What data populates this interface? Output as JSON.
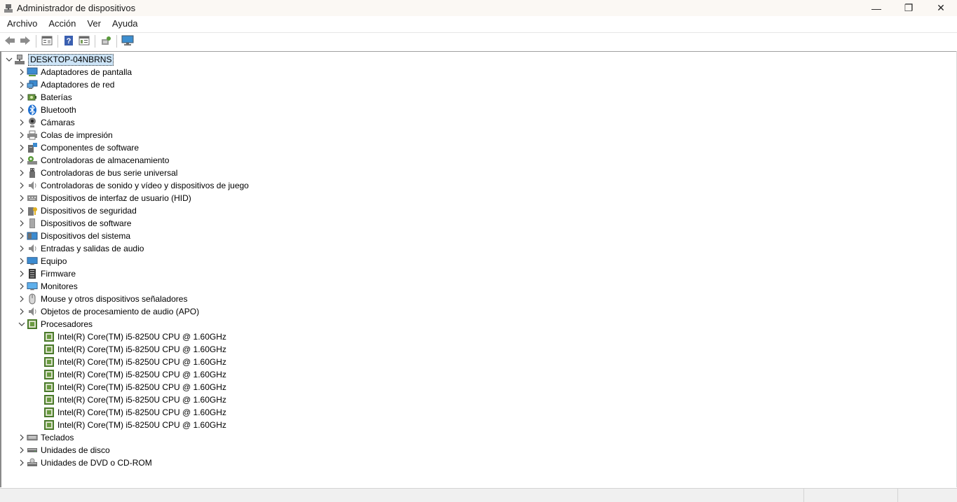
{
  "window": {
    "title": "Administrador de dispositivos",
    "minimize_glyph": "—",
    "restore_glyph": "❐",
    "close_glyph": "✕"
  },
  "menu": [
    "Archivo",
    "Acción",
    "Ver",
    "Ayuda"
  ],
  "toolbar": {
    "buttons": [
      "back-icon",
      "forward-icon",
      "properties-view-icon",
      "help-icon",
      "show-hide-tree-icon",
      "scan-hardware-icon",
      "monitor-icon"
    ]
  },
  "tree": {
    "root": "DESKTOP-04NBRNS",
    "categories": [
      {
        "label": "Adaptadores de pantalla",
        "icon": "display-adapter-icon",
        "expanded": false
      },
      {
        "label": "Adaptadores de red",
        "icon": "network-adapter-icon",
        "expanded": false
      },
      {
        "label": "Baterías",
        "icon": "battery-icon",
        "expanded": false
      },
      {
        "label": "Bluetooth",
        "icon": "bluetooth-icon",
        "expanded": false
      },
      {
        "label": "Cámaras",
        "icon": "camera-icon",
        "expanded": false
      },
      {
        "label": "Colas de impresión",
        "icon": "printer-icon",
        "expanded": false
      },
      {
        "label": "Componentes de software",
        "icon": "software-component-icon",
        "expanded": false
      },
      {
        "label": "Controladoras de almacenamiento",
        "icon": "storage-controller-icon",
        "expanded": false
      },
      {
        "label": "Controladoras de bus serie universal",
        "icon": "usb-icon",
        "expanded": false
      },
      {
        "label": "Controladoras de sonido y vídeo y dispositivos de juego",
        "icon": "speaker-icon",
        "expanded": false
      },
      {
        "label": "Dispositivos de interfaz de usuario (HID)",
        "icon": "hid-icon",
        "expanded": false
      },
      {
        "label": "Dispositivos de seguridad",
        "icon": "security-key-icon",
        "expanded": false
      },
      {
        "label": "Dispositivos de software",
        "icon": "software-device-icon",
        "expanded": false
      },
      {
        "label": "Dispositivos del sistema",
        "icon": "system-device-icon",
        "expanded": false
      },
      {
        "label": "Entradas y salidas de audio",
        "icon": "audio-io-icon",
        "expanded": false
      },
      {
        "label": "Equipo",
        "icon": "computer-icon",
        "expanded": false
      },
      {
        "label": "Firmware",
        "icon": "firmware-icon",
        "expanded": false
      },
      {
        "label": "Monitores",
        "icon": "monitor-icon",
        "expanded": false
      },
      {
        "label": "Mouse y otros dispositivos señaladores",
        "icon": "mouse-icon",
        "expanded": false
      },
      {
        "label": "Objetos de procesamiento de audio (APO)",
        "icon": "apo-icon",
        "expanded": false
      },
      {
        "label": "Procesadores",
        "icon": "processor-icon",
        "expanded": true,
        "children": [
          "Intel(R) Core(TM) i5-8250U CPU @ 1.60GHz",
          "Intel(R) Core(TM) i5-8250U CPU @ 1.60GHz",
          "Intel(R) Core(TM) i5-8250U CPU @ 1.60GHz",
          "Intel(R) Core(TM) i5-8250U CPU @ 1.60GHz",
          "Intel(R) Core(TM) i5-8250U CPU @ 1.60GHz",
          "Intel(R) Core(TM) i5-8250U CPU @ 1.60GHz",
          "Intel(R) Core(TM) i5-8250U CPU @ 1.60GHz",
          "Intel(R) Core(TM) i5-8250U CPU @ 1.60GHz"
        ]
      },
      {
        "label": "Teclados",
        "icon": "keyboard-icon",
        "expanded": false
      },
      {
        "label": "Unidades de disco",
        "icon": "disk-drive-icon",
        "expanded": false
      },
      {
        "label": "Unidades de DVD o CD-ROM",
        "icon": "dvd-drive-icon",
        "expanded": false
      }
    ]
  }
}
